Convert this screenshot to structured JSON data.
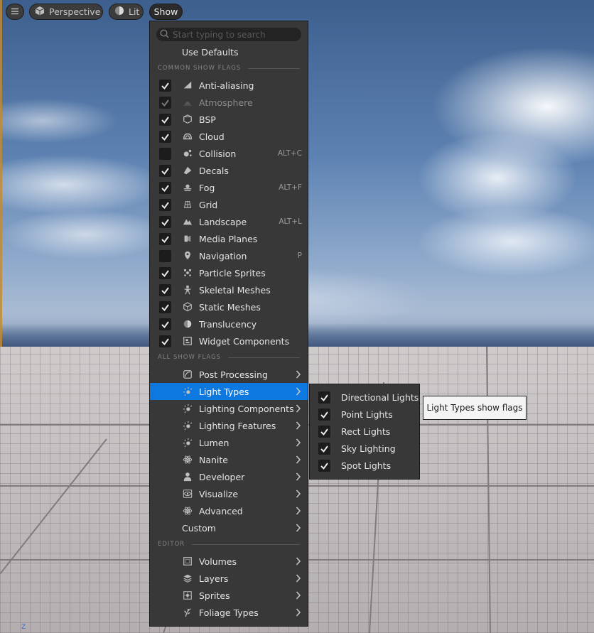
{
  "toolbar": {
    "menu_icon": "hamburger-icon",
    "perspective": "Perspective",
    "lit": "Lit",
    "show": "Show"
  },
  "search": {
    "placeholder": "Start typing to search"
  },
  "use_defaults": "Use Defaults",
  "sections": {
    "common": "COMMON SHOW FLAGS",
    "all": "ALL SHOW FLAGS",
    "editor": "EDITOR"
  },
  "common_flags": [
    {
      "label": "Anti-aliasing",
      "checked": true,
      "icon": "antialias-icon",
      "shortcut": ""
    },
    {
      "label": "Atmosphere",
      "checked": true,
      "disabled": true,
      "icon": "atmosphere-icon",
      "shortcut": ""
    },
    {
      "label": "BSP",
      "checked": true,
      "icon": "bsp-icon",
      "shortcut": ""
    },
    {
      "label": "Cloud",
      "checked": true,
      "icon": "cloud-icon",
      "shortcut": ""
    },
    {
      "label": "Collision",
      "checked": false,
      "icon": "collision-icon",
      "shortcut": "ALT+C"
    },
    {
      "label": "Decals",
      "checked": true,
      "icon": "decals-icon",
      "shortcut": ""
    },
    {
      "label": "Fog",
      "checked": true,
      "icon": "fog-icon",
      "shortcut": "ALT+F"
    },
    {
      "label": "Grid",
      "checked": true,
      "icon": "grid-icon",
      "shortcut": ""
    },
    {
      "label": "Landscape",
      "checked": true,
      "icon": "landscape-icon",
      "shortcut": "ALT+L"
    },
    {
      "label": "Media Planes",
      "checked": true,
      "icon": "media-planes-icon",
      "shortcut": ""
    },
    {
      "label": "Navigation",
      "checked": false,
      "icon": "navigation-icon",
      "shortcut": "P"
    },
    {
      "label": "Particle Sprites",
      "checked": true,
      "icon": "particle-icon",
      "shortcut": ""
    },
    {
      "label": "Skeletal Meshes",
      "checked": true,
      "icon": "skeletal-icon",
      "shortcut": ""
    },
    {
      "label": "Static Meshes",
      "checked": true,
      "icon": "static-mesh-icon",
      "shortcut": ""
    },
    {
      "label": "Translucency",
      "checked": true,
      "icon": "translucency-icon",
      "shortcut": ""
    },
    {
      "label": "Widget Components",
      "checked": true,
      "icon": "widget-icon",
      "shortcut": ""
    }
  ],
  "all_flags": [
    {
      "label": "Post Processing",
      "icon": "post-processing-icon"
    },
    {
      "label": "Light Types",
      "icon": "light-icon",
      "active": true
    },
    {
      "label": "Lighting Components",
      "icon": "light-icon"
    },
    {
      "label": "Lighting Features",
      "icon": "light-icon"
    },
    {
      "label": "Lumen",
      "icon": "light-icon"
    },
    {
      "label": "Nanite",
      "icon": "atom-icon"
    },
    {
      "label": "Developer",
      "icon": "person-icon"
    },
    {
      "label": "Visualize",
      "icon": "eye-icon"
    },
    {
      "label": "Advanced",
      "icon": "atom-icon"
    },
    {
      "label": "Custom",
      "icon": ""
    }
  ],
  "editor_flags": [
    {
      "label": "Volumes",
      "icon": "volume-icon"
    },
    {
      "label": "Layers",
      "icon": "layers-icon"
    },
    {
      "label": "Sprites",
      "icon": "sprite-icon"
    },
    {
      "label": "Foliage Types",
      "icon": "foliage-icon"
    }
  ],
  "light_types_submenu": [
    {
      "label": "Directional Lights",
      "checked": true
    },
    {
      "label": "Point Lights",
      "checked": true
    },
    {
      "label": "Rect Lights",
      "checked": true
    },
    {
      "label": "Sky Lighting",
      "checked": true
    },
    {
      "label": "Spot Lights",
      "checked": true
    }
  ],
  "tooltip": "Light Types show flags",
  "axis_label": "Z",
  "colors": {
    "accent": "#0c78e0",
    "menu_bg": "#383838",
    "checkbox_bg": "#1c1c1c"
  }
}
